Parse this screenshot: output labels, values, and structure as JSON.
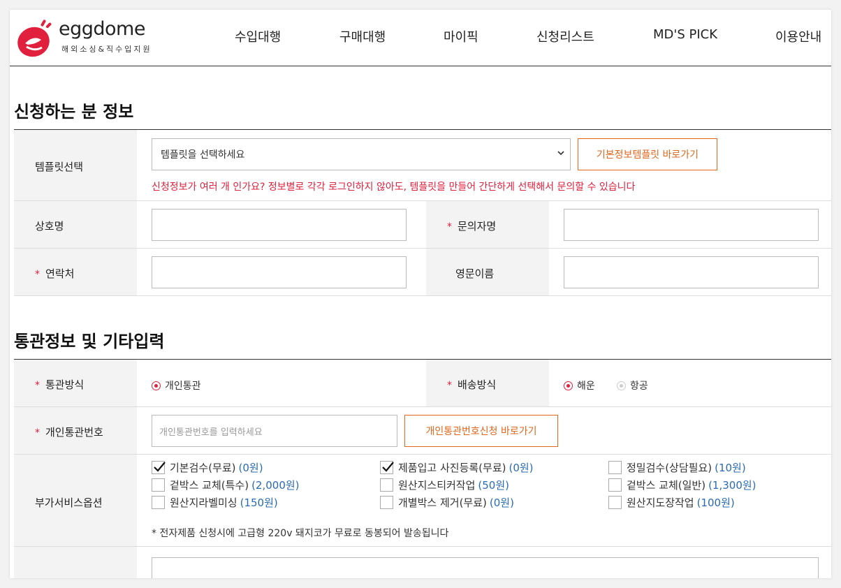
{
  "brand": {
    "name": "eggdome",
    "tagline": "해외소싱&직수입지원",
    "accent": "#e0203c",
    "orange": "#e2661c",
    "price_blue": "#2a6bb5"
  },
  "nav": {
    "items": [
      "수입대행",
      "구매대행",
      "마이픽",
      "신청리스트",
      "MD'S PICK",
      "이용안내"
    ]
  },
  "section1": {
    "title": "신청하는 분 정보",
    "template": {
      "label": "템플릿선택",
      "select_value": "템플릿을 선택하세요",
      "button": "기본정보템플릿 바로가기",
      "notice": "신청정보가 여러 개 인가요? 정보별로 각각 로그인하지 않아도, 템플릿을 만들어 간단하게 선택해서 문의할 수 있습니다"
    },
    "company": {
      "label": "상호명",
      "value": ""
    },
    "inquirer": {
      "required_mark": "*",
      "label": "문의자명",
      "value": ""
    },
    "contact": {
      "required_mark": "*",
      "label": "연락처",
      "value": ""
    },
    "english_name": {
      "label": "영문이름",
      "value": ""
    }
  },
  "section2": {
    "title": "통관정보 및 기타입력",
    "customs_method": {
      "required_mark": "*",
      "label": "통관방식",
      "options": [
        {
          "label": "개인통관",
          "selected": true
        }
      ]
    },
    "shipping_method": {
      "required_mark": "*",
      "label": "배송방식",
      "options": [
        {
          "label": "해운",
          "selected": true
        },
        {
          "label": "항공",
          "selected": false
        }
      ]
    },
    "customs_number": {
      "required_mark": "*",
      "label": "개인통관번호",
      "placeholder": "개인통관번호를 입력하세요",
      "button": "개인통관번호신청 바로가기"
    },
    "extra_services": {
      "label": "부가서비스옵션",
      "options": [
        {
          "label": "기본검수(무료)",
          "price": "(0원)",
          "checked": true
        },
        {
          "label": "제품입고 사진등록(무료)",
          "price": "(0원)",
          "checked": true
        },
        {
          "label": "정밀검수(상담필요)",
          "price": "(10원)",
          "checked": false
        },
        {
          "label": "겉박스 교체(특수)",
          "price": "(2,000원)",
          "checked": false
        },
        {
          "label": "원산지스티커작업",
          "price": "(50원)",
          "checked": false
        },
        {
          "label": "겉박스 교체(일반)",
          "price": "(1,300원)",
          "checked": false
        },
        {
          "label": "원산지라벨미싱",
          "price": "(150원)",
          "checked": false
        },
        {
          "label": "개별박스 제거(무료)",
          "price": "(0원)",
          "checked": false
        },
        {
          "label": "원산지도장작업",
          "price": "(100원)",
          "checked": false
        }
      ],
      "note": "* 전자제품 신청시에 고급형 220v 돼지코가 무료로 동봉되어 발송됩니다"
    }
  }
}
